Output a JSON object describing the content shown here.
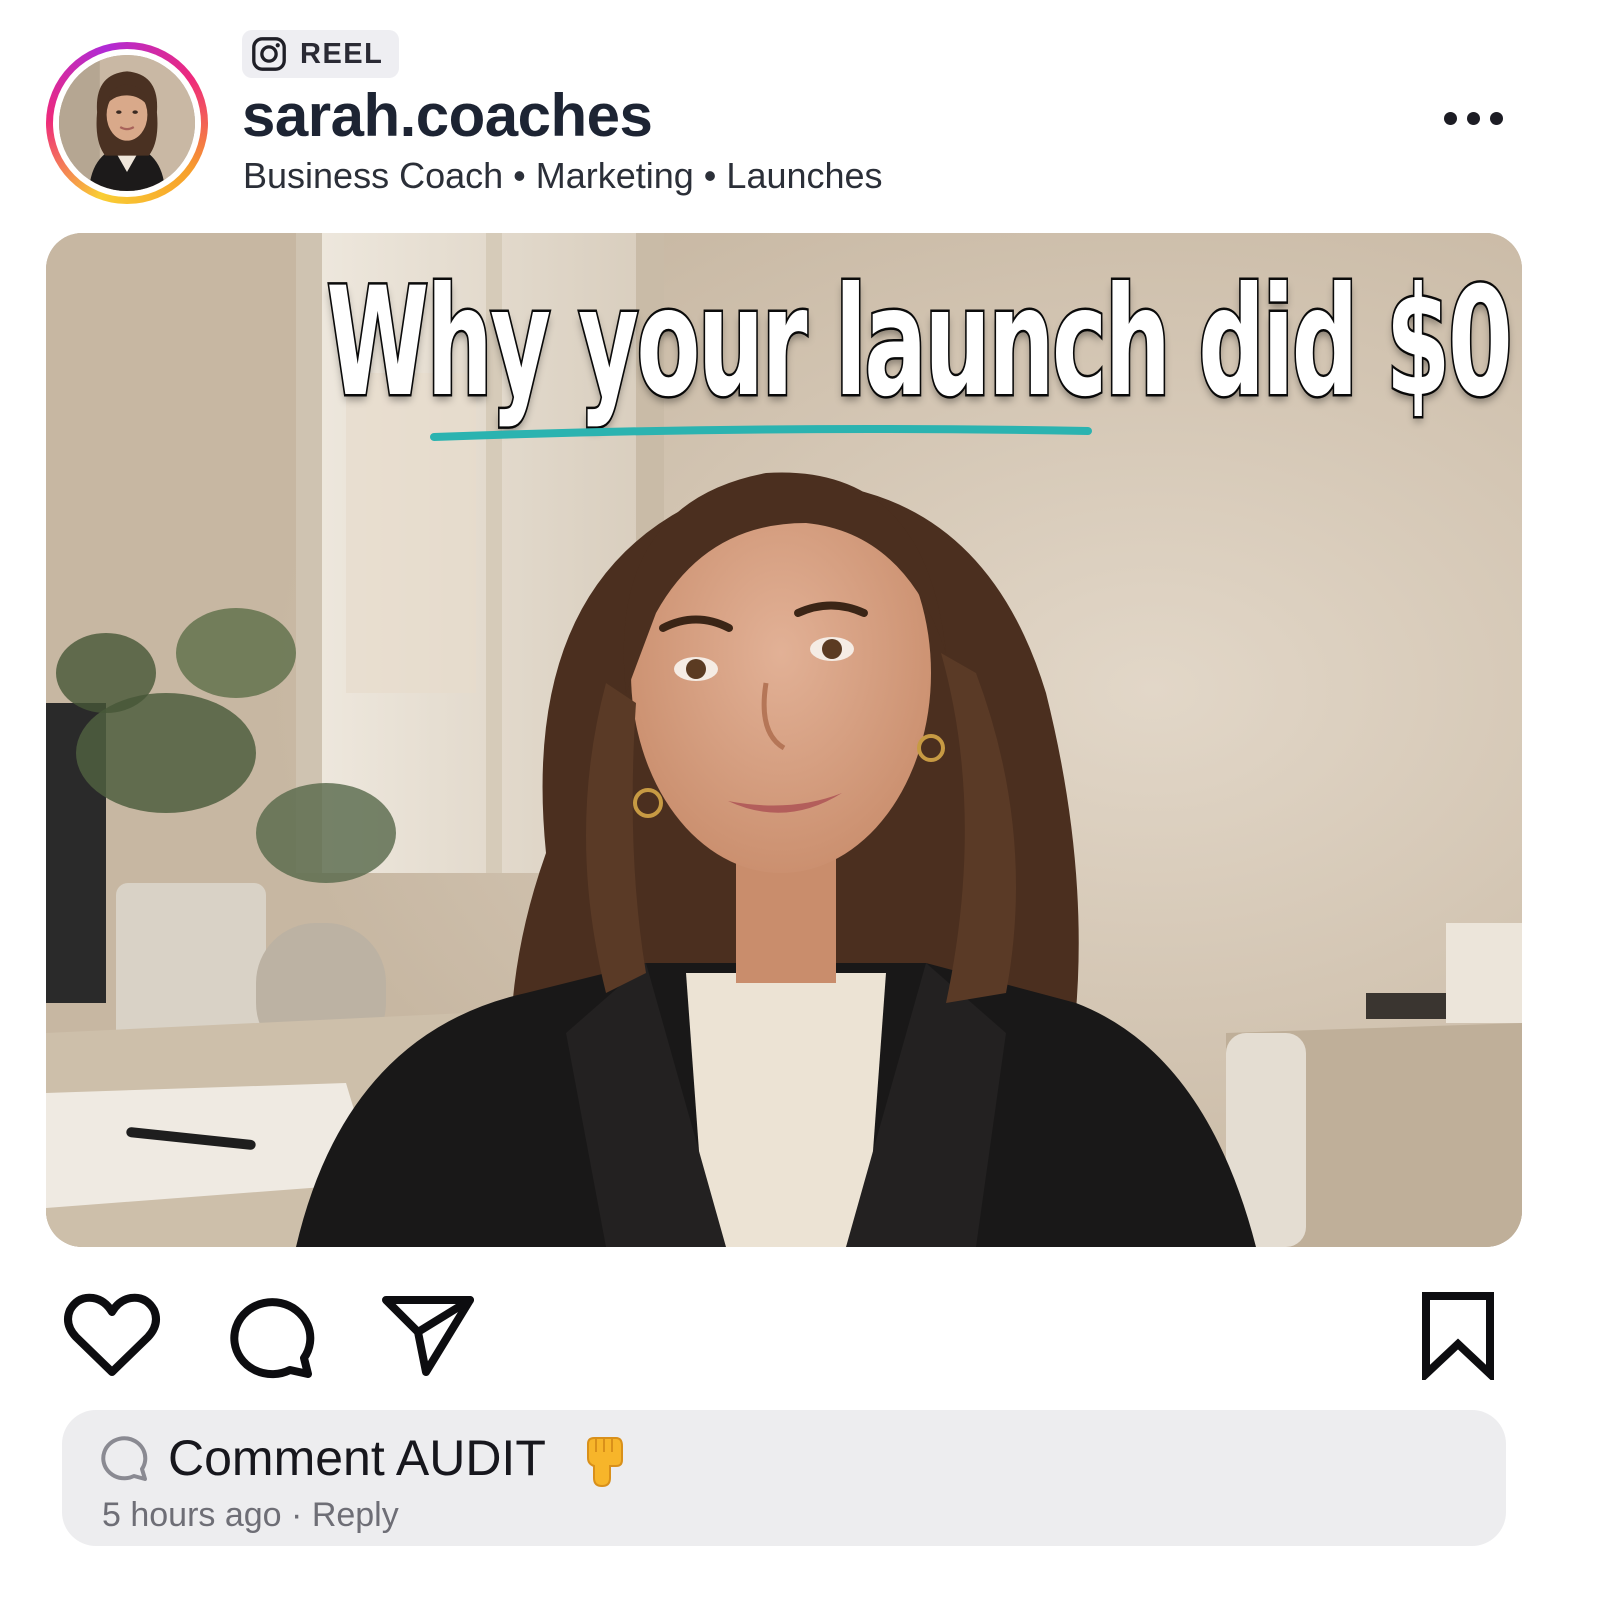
{
  "post": {
    "type_badge": "REEL",
    "username": "sarah.coaches",
    "tagline": "Business Coach • Marketing • Launches",
    "headline": "Why your launch did $0"
  },
  "actions": {
    "like_icon": "heart-icon",
    "comment_icon": "comment-icon",
    "share_icon": "paper-plane-icon",
    "save_icon": "bookmark-icon"
  },
  "comment": {
    "text": "Comment AUDIT",
    "emoji": "👇",
    "time": "5 hours ago",
    "separator": " · ",
    "reply": "Reply"
  },
  "colors": {
    "accent_underline": "#2bb3b0",
    "username": "#1d2433"
  }
}
